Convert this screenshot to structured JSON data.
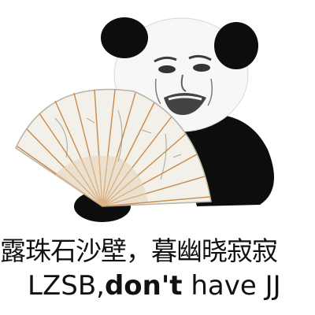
{
  "caption": {
    "chinese_line": "露珠石沙壁，暮幽晓寂寂",
    "english_prefix": "LZSB,",
    "english_bold": "don't",
    "english_suffix": " have JJ"
  },
  "illustration": {
    "subject": "panda-meme-face-with-folding-fan",
    "ink_color": "#0d0d0d",
    "fan_paper_color": "#f2f0e9",
    "fan_rib_color": "#c98a4a"
  }
}
